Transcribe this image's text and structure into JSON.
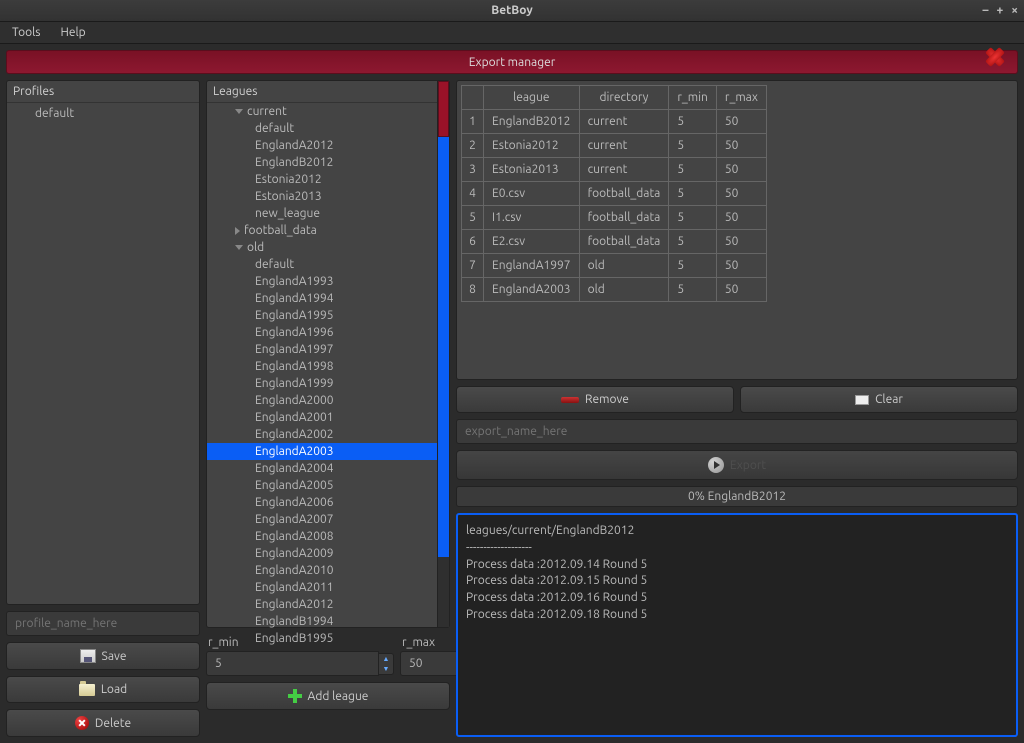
{
  "window": {
    "title": "BetBoy"
  },
  "menu": {
    "tools": "Tools",
    "help": "Help"
  },
  "banner": {
    "title": "Export manager"
  },
  "profiles": {
    "header": "Profiles",
    "items": [
      "default"
    ],
    "placeholder": "profile_name_here"
  },
  "buttons": {
    "save": "Save",
    "load": "Load",
    "delete": "Delete",
    "add_league": "Add league",
    "remove": "Remove",
    "clear": "Clear",
    "export": "Export"
  },
  "leagues": {
    "header": "Leagues",
    "r_min_label": "r_min",
    "r_max_label": "r_max",
    "r_min": "5",
    "r_max": "50",
    "tree": [
      {
        "label": "current",
        "expanded": true,
        "children": [
          "default",
          "EnglandA2012",
          "EnglandB2012",
          "Estonia2012",
          "Estonia2013",
          "new_league"
        ]
      },
      {
        "label": "football_data",
        "expanded": false
      },
      {
        "label": "old",
        "expanded": true,
        "children": [
          "default",
          "EnglandA1993",
          "EnglandA1994",
          "EnglandA1995",
          "EnglandA1996",
          "EnglandA1997",
          "EnglandA1998",
          "EnglandA1999",
          "EnglandA2000",
          "EnglandA2001",
          "EnglandA2002",
          "EnglandA2003",
          "EnglandA2004",
          "EnglandA2005",
          "EnglandA2006",
          "EnglandA2007",
          "EnglandA2008",
          "EnglandA2009",
          "EnglandA2010",
          "EnglandA2011",
          "EnglandA2012",
          "EnglandB1994",
          "EnglandB1995"
        ]
      }
    ],
    "selected": "EnglandA2003"
  },
  "table": {
    "headers": [
      "league",
      "directory",
      "r_min",
      "r_max"
    ],
    "rows": [
      {
        "n": "1",
        "league": "EnglandB2012",
        "directory": "current",
        "r_min": "5",
        "r_max": "50"
      },
      {
        "n": "2",
        "league": "Estonia2012",
        "directory": "current",
        "r_min": "5",
        "r_max": "50"
      },
      {
        "n": "3",
        "league": "Estonia2013",
        "directory": "current",
        "r_min": "5",
        "r_max": "50"
      },
      {
        "n": "4",
        "league": "E0.csv",
        "directory": "football_data",
        "r_min": "5",
        "r_max": "50"
      },
      {
        "n": "5",
        "league": "I1.csv",
        "directory": "football_data",
        "r_min": "5",
        "r_max": "50"
      },
      {
        "n": "6",
        "league": "E2.csv",
        "directory": "football_data",
        "r_min": "5",
        "r_max": "50"
      },
      {
        "n": "7",
        "league": "EnglandA1997",
        "directory": "old",
        "r_min": "5",
        "r_max": "50"
      },
      {
        "n": "8",
        "league": "EnglandA2003",
        "directory": "old",
        "r_min": "5",
        "r_max": "50"
      }
    ]
  },
  "export_name": {
    "placeholder": "export_name_here"
  },
  "progress": {
    "text": "0% EnglandB2012"
  },
  "log": {
    "lines": [
      "leagues/current/EnglandB2012",
      "-------------------",
      "Process data :2012.09.14 Round 5",
      "Process data :2012.09.15 Round 5",
      "Process data :2012.09.16 Round 5",
      "Process data :2012.09.18 Round 5"
    ]
  }
}
